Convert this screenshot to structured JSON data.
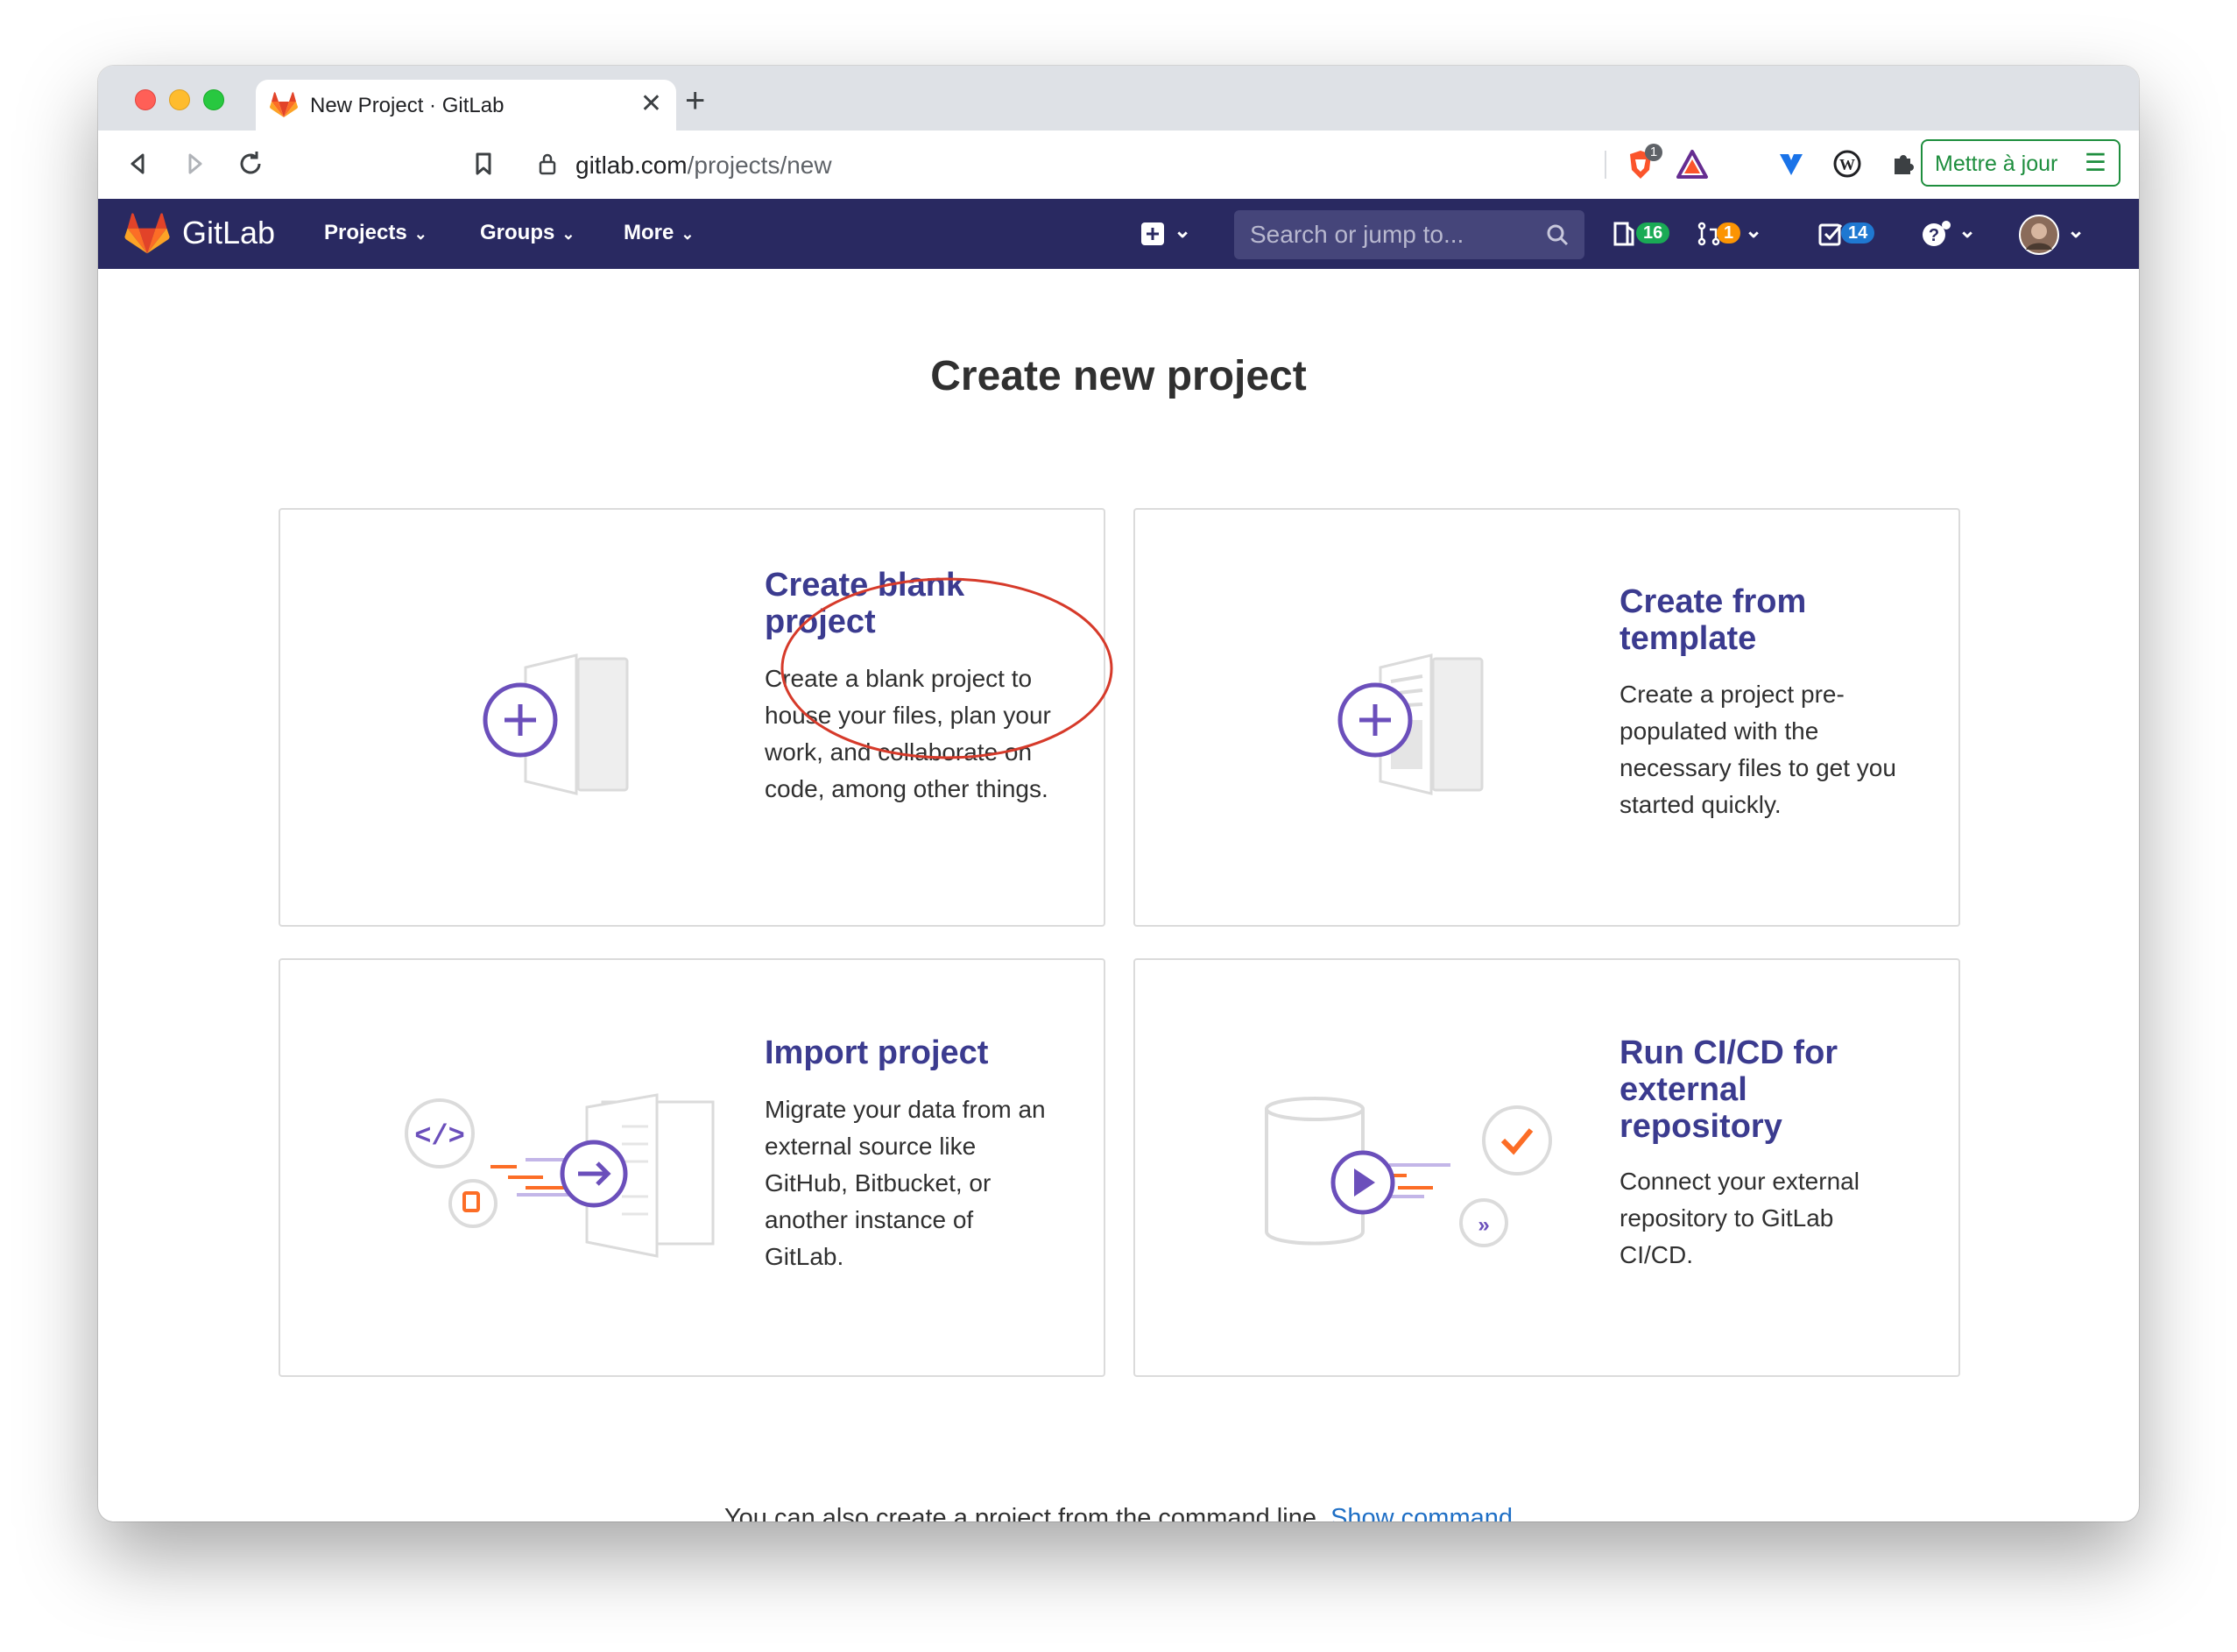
{
  "browser": {
    "tab_title": "New Project · GitLab",
    "url_domain": "gitlab.com",
    "url_path": "/projects/new",
    "update_button": "Mettre à jour",
    "brave_badge": "1"
  },
  "navbar": {
    "brand": "GitLab",
    "menu": [
      {
        "label": "Projects"
      },
      {
        "label": "Groups"
      },
      {
        "label": "More"
      }
    ],
    "search_placeholder": "Search or jump to...",
    "issues_count": "16",
    "merge_requests_count": "1",
    "todos_count": "14",
    "colors": {
      "navbar_bg": "#292961",
      "issues": "#1aaa55",
      "merge_requests": "#fc9403",
      "todos": "#1f78d1"
    }
  },
  "main": {
    "title": "Create new project",
    "cards": [
      {
        "title": "Create blank project",
        "description": "Create a blank project to house your files, plan your work, and collaborate on code, among other things.",
        "icon": "blank-project-illustration"
      },
      {
        "title": "Create from template",
        "description": "Create a project pre-populated with the necessary files to get you started quickly.",
        "icon": "template-project-illustration"
      },
      {
        "title": "Import project",
        "description": "Migrate your data from an external source like GitHub, Bitbucket, or another instance of GitLab.",
        "icon": "import-project-illustration"
      },
      {
        "title": "Run CI/CD for external repository",
        "description": "Connect your external repository to GitLab CI/CD.",
        "icon": "cicd-project-illustration"
      }
    ],
    "footer_text": "You can also create a project from the command line.",
    "footer_link": "Show command"
  }
}
